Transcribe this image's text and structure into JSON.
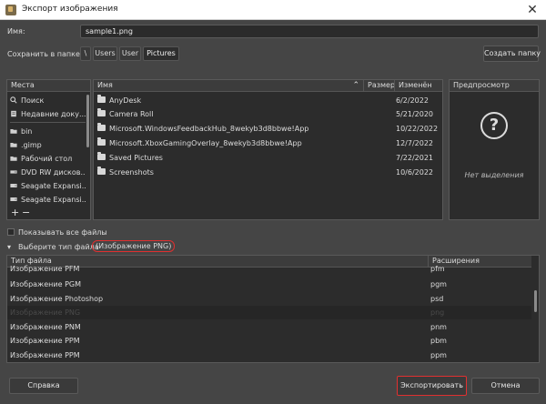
{
  "window": {
    "title": "Экспорт изображения"
  },
  "name_row": {
    "label": "Имя:",
    "value": "sample1.png"
  },
  "folder_row": {
    "label": "Сохранить в папке",
    "crumbs": [
      "\\",
      "Users",
      "User",
      "Pictures"
    ],
    "create_folder_label": "Создать папку"
  },
  "places": {
    "header": "Места",
    "items": [
      {
        "label": "Поиск",
        "icon": "search-icon"
      },
      {
        "label": "Недавние доку...",
        "icon": "recent-documents-icon"
      },
      {
        "label": "bin",
        "icon": "folder-icon"
      },
      {
        "label": ".gimp",
        "icon": "folder-icon"
      },
      {
        "label": "Рабочий стол",
        "icon": "folder-icon"
      },
      {
        "label": "DVD RW дисков...",
        "icon": "optical-drive-icon"
      },
      {
        "label": "Seagate Expansi...",
        "icon": "drive-icon"
      },
      {
        "label": "Seagate Expansi...",
        "icon": "drive-icon"
      }
    ],
    "add_label": "+",
    "remove_label": "−"
  },
  "files": {
    "columns": {
      "name": "Имя",
      "size": "Размер",
      "modified": "Изменён"
    },
    "rows": [
      {
        "name": "AnyDesk",
        "modified": "6/2/2022"
      },
      {
        "name": "Camera Roll",
        "modified": "5/21/2020"
      },
      {
        "name": "Microsoft.WindowsFeedbackHub_8wekyb3d8bbwe!App",
        "modified": "10/22/2022"
      },
      {
        "name": "Microsoft.XboxGamingOverlay_8wekyb3d8bbwe!App",
        "modified": "12/7/2022"
      },
      {
        "name": "Saved Pictures",
        "modified": "7/22/2021"
      },
      {
        "name": "Screenshots",
        "modified": "10/6/2022"
      }
    ]
  },
  "preview": {
    "header": "Предпросмотр",
    "icon_glyph": "?",
    "empty_text": "Нет выделения"
  },
  "show_all": {
    "label": "Показывать все файлы"
  },
  "filetype": {
    "label": "Выберите тип файла",
    "selected": "(Изображение PNG)"
  },
  "types": {
    "columns": {
      "type": "Тип файла",
      "ext": "Расширения"
    },
    "rows": [
      {
        "type": "Изображение PFM",
        "ext": "pfm"
      },
      {
        "type": "Изображение PGM",
        "ext": "pgm"
      },
      {
        "type": "Изображение Photoshop",
        "ext": "psd"
      },
      {
        "type": "Изображение PNG",
        "ext": "png"
      },
      {
        "type": "Изображение PNM",
        "ext": "pnm"
      },
      {
        "type": "Изображение PPM",
        "ext": "pbm"
      },
      {
        "type": "Изображение PPM",
        "ext": "ppm"
      }
    ]
  },
  "footer": {
    "help": "Справка",
    "export": "Экспортировать",
    "cancel": "Отмена"
  },
  "colors": {
    "background": "#454545",
    "panel": "#2c2c2c",
    "highlight": "#e03030"
  }
}
